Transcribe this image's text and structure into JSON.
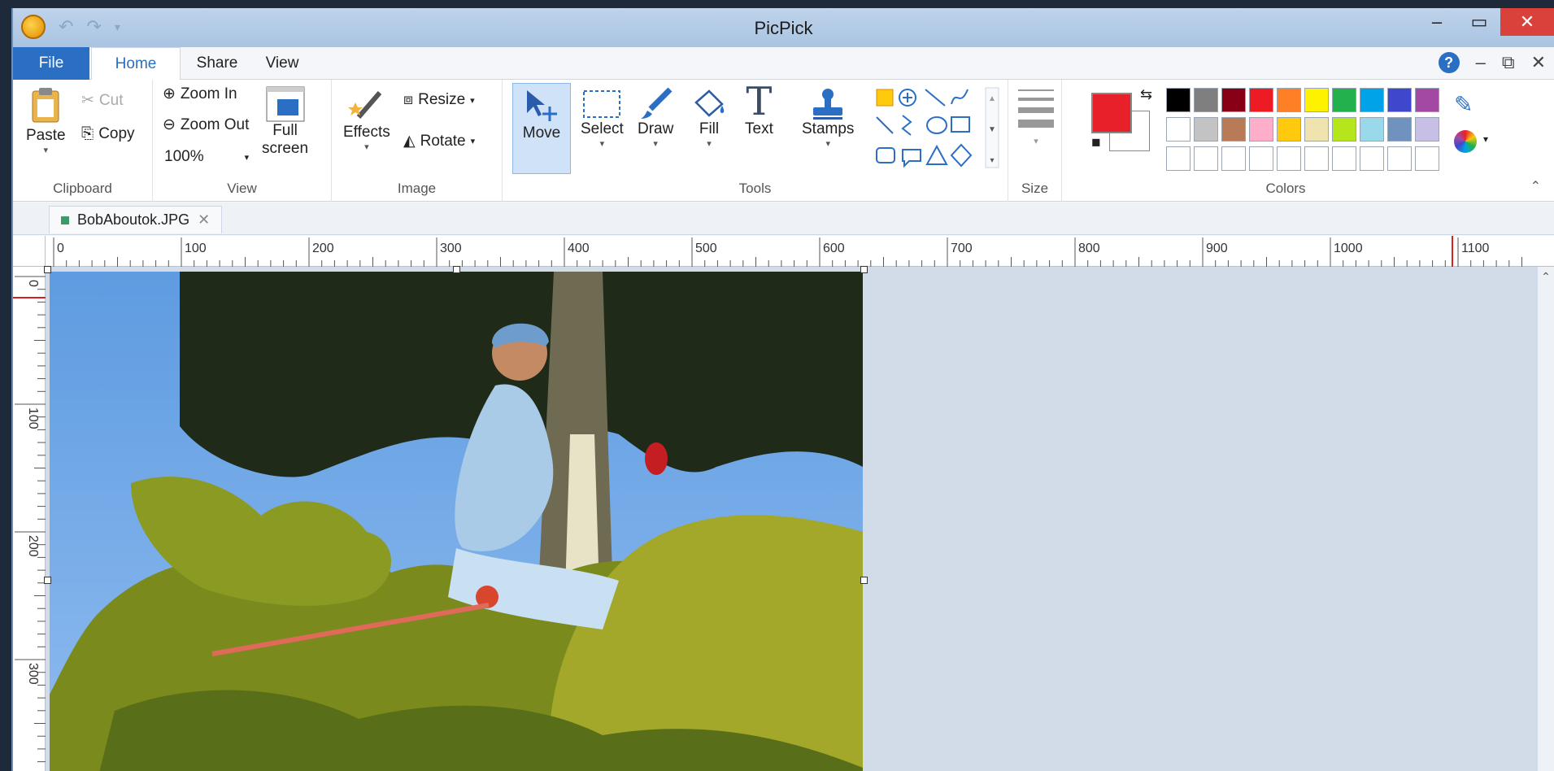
{
  "window": {
    "title": "PicPick"
  },
  "qat": {
    "undo": "↶",
    "redo": "↷",
    "more": "▾"
  },
  "tabs": {
    "file": "File",
    "home": "Home",
    "share": "Share",
    "view": "View"
  },
  "clipboard": {
    "paste": "Paste",
    "cut": "Cut",
    "copy": "Copy",
    "label": "Clipboard"
  },
  "view": {
    "zoom_in": "Zoom In",
    "zoom_out": "Zoom Out",
    "zoom_value": "100%",
    "full": "Full",
    "screen": "screen",
    "label": "View"
  },
  "image": {
    "effects": "Effects",
    "resize": "Resize",
    "rotate": "Rotate",
    "label": "Image"
  },
  "tools": {
    "move": "Move",
    "select": "Select",
    "draw": "Draw",
    "fill": "Fill",
    "text": "Text",
    "text_glyph": "T",
    "stamps": "Stamps",
    "label": "Tools"
  },
  "size": {
    "label": "Size"
  },
  "colors": {
    "label": "Colors",
    "primary": "#e8202a",
    "secondary": "#ffffff",
    "palette_row1": [
      "#000000",
      "#7f7f7f",
      "#880015",
      "#ed1c24",
      "#ff7f27",
      "#fff200",
      "#22b14c",
      "#00a2e8",
      "#3f48cc",
      "#a349a4"
    ],
    "palette_row2": [
      "#ffffff",
      "#c3c3c3",
      "#b97a57",
      "#ffaec9",
      "#ffc90e",
      "#efe4b0",
      "#b5e61d",
      "#99d9ea",
      "#7092be",
      "#c8bfe7"
    ],
    "palette_row3": [
      "#ffffff",
      "#ffffff",
      "#ffffff",
      "#ffffff",
      "#ffffff",
      "#ffffff",
      "#ffffff",
      "#ffffff",
      "#ffffff",
      "#ffffff"
    ]
  },
  "document": {
    "tab_name": "BobAboutok.JPG"
  },
  "ruler_h": [
    "0",
    "100",
    "200",
    "300",
    "400",
    "500",
    "600",
    "700",
    "800",
    "900",
    "1000",
    "1100"
  ],
  "ruler_v": [
    "0",
    "100",
    "200",
    "300"
  ]
}
